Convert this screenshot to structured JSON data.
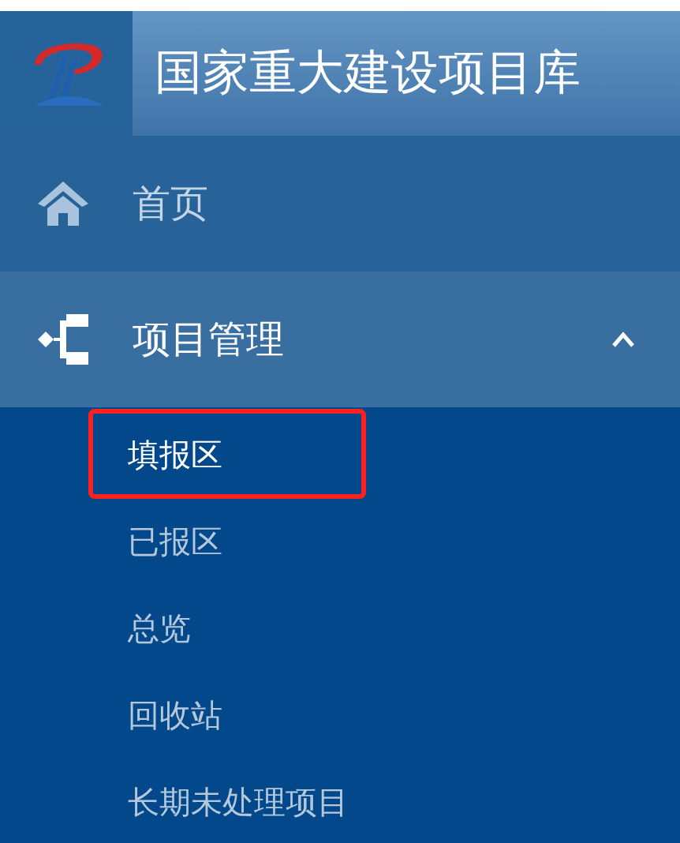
{
  "header": {
    "title": "国家重大建设项目库"
  },
  "nav": [
    {
      "label": "首页",
      "kind": "link"
    },
    {
      "label": "项目管理",
      "kind": "group",
      "expanded": true,
      "children": [
        {
          "label": "填报区",
          "selected": true
        },
        {
          "label": "已报区",
          "selected": false
        },
        {
          "label": "总览",
          "selected": false
        },
        {
          "label": "回收站",
          "selected": false
        },
        {
          "label": "长期未处理项目",
          "selected": false
        }
      ]
    }
  ]
}
